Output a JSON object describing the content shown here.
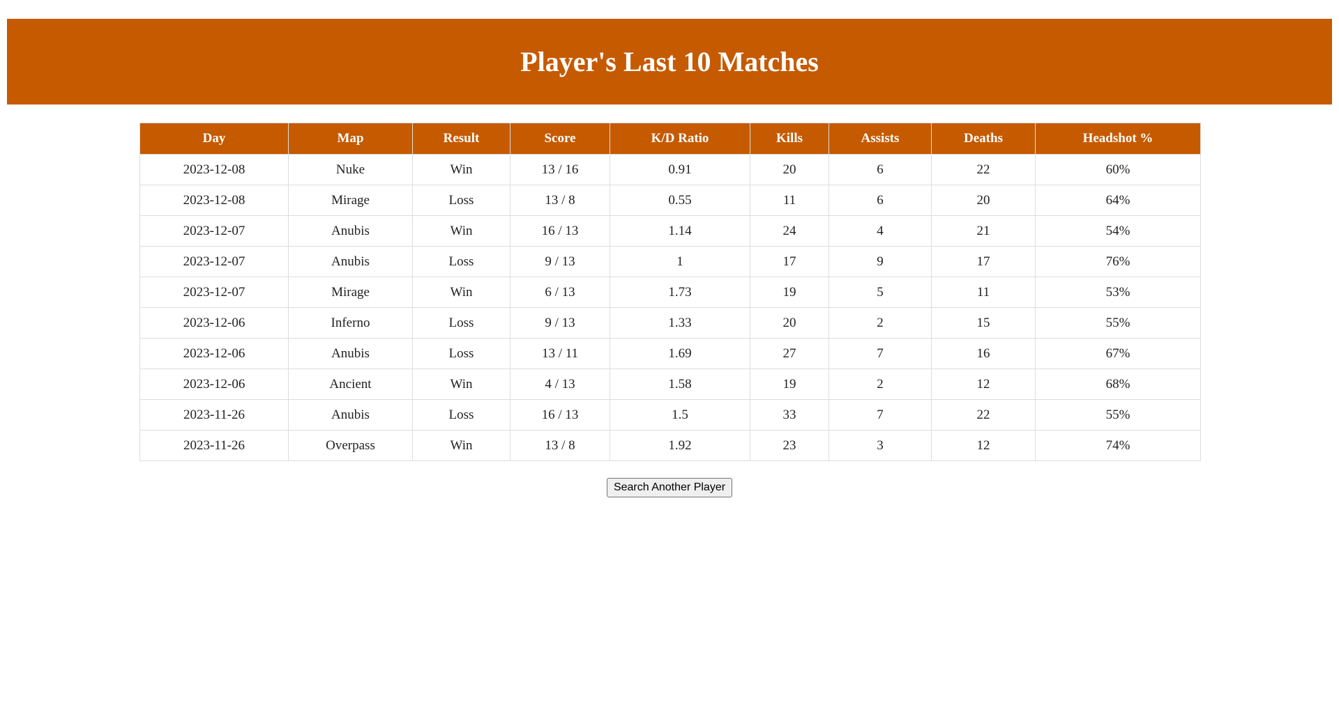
{
  "header": {
    "title": "Player's Last 10 Matches"
  },
  "table": {
    "columns": [
      "Day",
      "Map",
      "Result",
      "Score",
      "K/D Ratio",
      "Kills",
      "Assists",
      "Deaths",
      "Headshot %"
    ],
    "rows": [
      [
        "2023-12-08",
        "Nuke",
        "Win",
        "13 / 16",
        "0.91",
        "20",
        "6",
        "22",
        "60%"
      ],
      [
        "2023-12-08",
        "Mirage",
        "Loss",
        "13 / 8",
        "0.55",
        "11",
        "6",
        "20",
        "64%"
      ],
      [
        "2023-12-07",
        "Anubis",
        "Win",
        "16 / 13",
        "1.14",
        "24",
        "4",
        "21",
        "54%"
      ],
      [
        "2023-12-07",
        "Anubis",
        "Loss",
        "9 / 13",
        "1",
        "17",
        "9",
        "17",
        "76%"
      ],
      [
        "2023-12-07",
        "Mirage",
        "Win",
        "6 / 13",
        "1.73",
        "19",
        "5",
        "11",
        "53%"
      ],
      [
        "2023-12-06",
        "Inferno",
        "Loss",
        "9 / 13",
        "1.33",
        "20",
        "2",
        "15",
        "55%"
      ],
      [
        "2023-12-06",
        "Anubis",
        "Loss",
        "13 / 11",
        "1.69",
        "27",
        "7",
        "16",
        "67%"
      ],
      [
        "2023-12-06",
        "Ancient",
        "Win",
        "4 / 13",
        "1.58",
        "19",
        "2",
        "12",
        "68%"
      ],
      [
        "2023-11-26",
        "Anubis",
        "Loss",
        "16 / 13",
        "1.5",
        "33",
        "7",
        "22",
        "55%"
      ],
      [
        "2023-11-26",
        "Overpass",
        "Win",
        "13 / 8",
        "1.92",
        "23",
        "3",
        "12",
        "74%"
      ]
    ]
  },
  "actions": {
    "search_label": "Search Another Player"
  },
  "colors": {
    "accent": "#c55a00",
    "header_text": "#ffffff",
    "border": "#dddddd"
  }
}
